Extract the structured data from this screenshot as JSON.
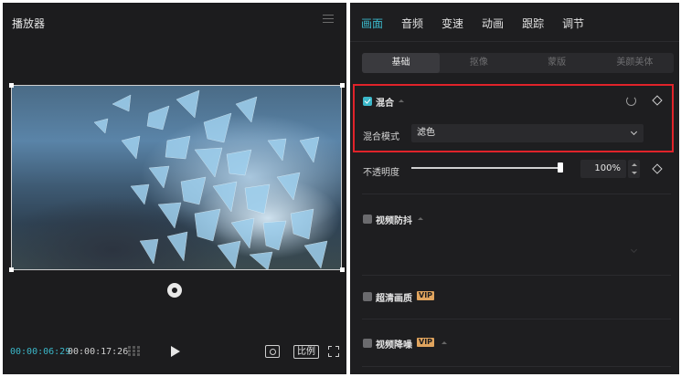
{
  "player": {
    "title": "播放器",
    "current_time": "00:00:06:29",
    "total_time": "00:00:17:26",
    "ratio_label": "比例"
  },
  "tabs": [
    {
      "label": "画面",
      "active": true
    },
    {
      "label": "音频",
      "active": false
    },
    {
      "label": "变速",
      "active": false
    },
    {
      "label": "动画",
      "active": false
    },
    {
      "label": "跟踪",
      "active": false
    },
    {
      "label": "调节",
      "active": false
    }
  ],
  "subtabs": [
    {
      "label": "基础",
      "active": true
    },
    {
      "label": "抠像",
      "active": false
    },
    {
      "label": "蒙版",
      "active": false
    },
    {
      "label": "美颜美体",
      "active": false
    }
  ],
  "blend": {
    "label": "混合",
    "checked": true,
    "mode_label": "混合模式",
    "mode_value": "滤色"
  },
  "opacity": {
    "label": "不透明度",
    "value": "100%",
    "level": 1.0
  },
  "stabilize": {
    "label": "视频防抖",
    "checked": false
  },
  "hd": {
    "label": "超清画质",
    "badge": "VIP",
    "checked": false
  },
  "denoise": {
    "label": "视频降噪",
    "badge": "VIP",
    "checked": false
  },
  "colors": {
    "accent": "#3bb7c9",
    "highlight": "#e0232a",
    "vip": "#e0a45e"
  }
}
